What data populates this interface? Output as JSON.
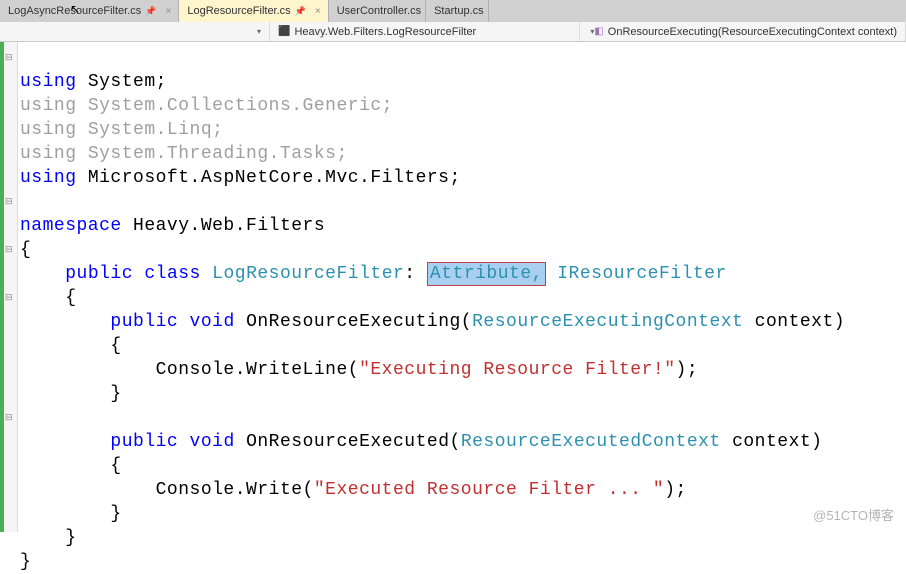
{
  "tabs": [
    {
      "label": "LogAsyncResourceFilter.cs",
      "active": false,
      "pinned": true
    },
    {
      "label": "LogResourceFilter.cs",
      "active": true,
      "pinned": true
    },
    {
      "label": "UserController.cs",
      "active": false,
      "pinned": false
    },
    {
      "label": "Startup.cs",
      "active": false,
      "pinned": false
    }
  ],
  "breadcrumb": {
    "namespace": "Heavy.Web.Filters.LogResourceFilter",
    "member": "OnResourceExecuting(ResourceExecutingContext context)"
  },
  "code": {
    "u1a": "using",
    "u1b": " System;",
    "u2a": "using",
    "u2b": " System.Collections.Generic;",
    "u3a": "using",
    "u3b": " System.Linq;",
    "u4a": "using",
    "u4b": " System.Threading.Tasks;",
    "u5a": "using",
    "u5b": " Microsoft.AspNetCore.Mvc.Filters;",
    "ns": "namespace",
    "nsVal": " Heavy.Web.Filters",
    "ob": "{",
    "pub": "public",
    "cls": "class",
    "clsName": " LogResourceFilter",
    "colon": ":",
    "attr": "Attribute,",
    "iface": " IResourceFilter",
    "ob2": "    {",
    "m1_pub": "public",
    "m1_void": "void",
    "m1_name": " OnResourceExecuting(",
    "m1_type": "ResourceExecutingContext",
    "m1_rest": " context)",
    "m1_ob": "        {",
    "m1_body_a": "            Console.WriteLine(",
    "m1_str": "\"Executing Resource Filter!\"",
    "m1_body_b": ");",
    "m1_cb": "        }",
    "m2_pub": "public",
    "m2_void": "void",
    "m2_name": " OnResourceExecuted(",
    "m2_type": "ResourceExecutedContext",
    "m2_rest": " context)",
    "m2_ob": "        {",
    "m2_body_a": "            Console.Write(",
    "m2_str": "\"Executed Resource Filter ... \"",
    "m2_body_b": ");",
    "m2_cb": "        }",
    "cb2": "    }",
    "cb": "}"
  },
  "watermark": "@51CTO博客"
}
